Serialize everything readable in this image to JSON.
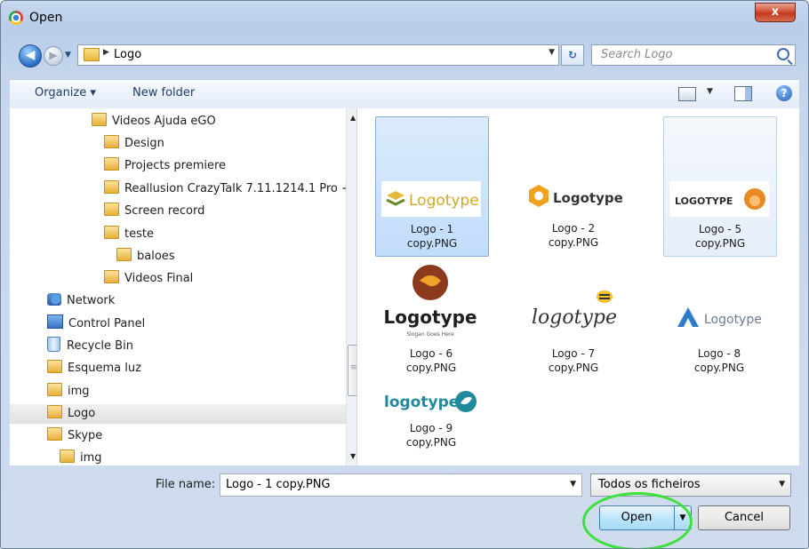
{
  "window": {
    "title": "Open",
    "close_label": "x"
  },
  "nav": {
    "path": "Logo",
    "search_placeholder": "Search Logo"
  },
  "toolbar": {
    "organize_label": "Organize ▾",
    "new_folder_label": "New folder"
  },
  "sidebar": {
    "items": [
      {
        "label": "Videos Ajuda eGO",
        "icon": "folder-icon"
      },
      {
        "label": "Design",
        "icon": "folder-icon"
      },
      {
        "label": "Projects premiere",
        "icon": "folder-icon"
      },
      {
        "label": "Reallusion CrazyTalk 7.11.1214.1 Pro +",
        "icon": "folder-icon"
      },
      {
        "label": "Screen record",
        "icon": "folder-icon"
      },
      {
        "label": "teste",
        "icon": "folder-icon"
      },
      {
        "label": "baloes",
        "icon": "folder-icon"
      },
      {
        "label": "Videos Final",
        "icon": "folder-icon"
      },
      {
        "label": "Network",
        "icon": "network-icon"
      },
      {
        "label": "Control Panel",
        "icon": "control-panel-icon"
      },
      {
        "label": "Recycle Bin",
        "icon": "recycle-bin-icon"
      },
      {
        "label": "Esquema luz",
        "icon": "folder-icon"
      },
      {
        "label": "img",
        "icon": "folder-icon"
      },
      {
        "label": "Logo",
        "icon": "folder-icon",
        "selected": true
      },
      {
        "label": "Skype",
        "icon": "folder-icon"
      },
      {
        "label": "img",
        "icon": "folder-icon"
      }
    ]
  },
  "files": [
    {
      "name_line1": "Logo - 1",
      "name_line2": "copy.PNG",
      "logo_text": "Logotype",
      "state": "selected"
    },
    {
      "name_line1": "Logo - 2",
      "name_line2": "copy.PNG",
      "logo_text": "Logotype",
      "state": "normal"
    },
    {
      "name_line1": "Logo - 5",
      "name_line2": "copy.PNG",
      "logo_text": "LOGOTYPE",
      "state": "hover"
    },
    {
      "name_line1": "Logo - 6",
      "name_line2": "copy.PNG",
      "logo_text": "Logotype",
      "logo_subtext": "Slogan Goes Here",
      "state": "normal"
    },
    {
      "name_line1": "Logo - 7",
      "name_line2": "copy.PNG",
      "logo_text": "logotype",
      "state": "normal"
    },
    {
      "name_line1": "Logo - 8",
      "name_line2": "copy.PNG",
      "logo_text": "Logotype",
      "state": "normal"
    },
    {
      "name_line1": "Logo - 9",
      "name_line2": "copy.PNG",
      "logo_text": "logotype",
      "state": "normal"
    }
  ],
  "footer": {
    "file_name_label": "File name:",
    "file_name_value": "Logo - 1 copy.PNG",
    "file_type_value": "Todos os ficheiros",
    "open_label": "Open",
    "cancel_label": "Cancel"
  },
  "colors": {
    "highlight_ring": "#3ce13c",
    "selection": "#c1dcfb"
  }
}
